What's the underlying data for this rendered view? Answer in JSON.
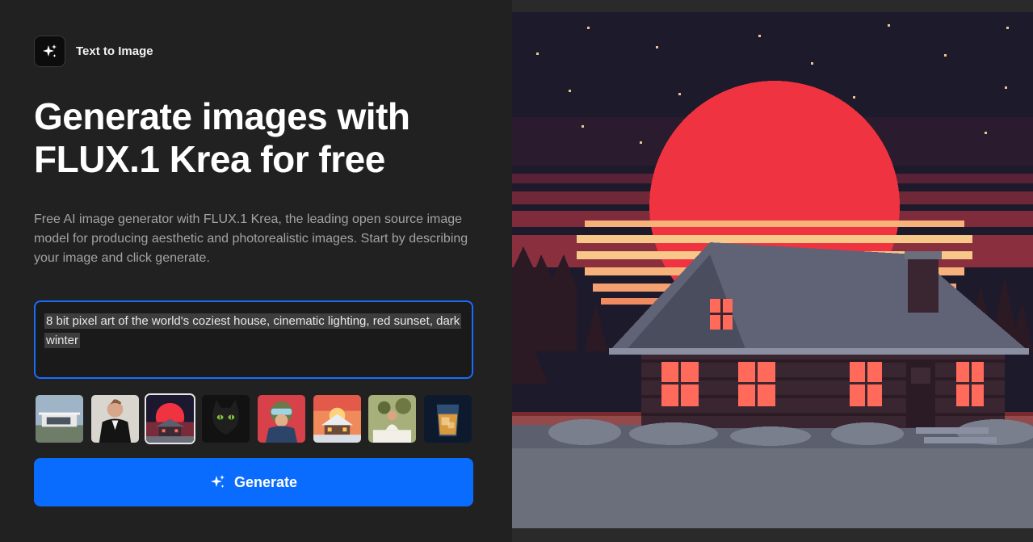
{
  "badge": {
    "label": "Text to Image",
    "icon": "sparkle-icon"
  },
  "hero": {
    "title": "Generate images with FLUX.1 Krea for free",
    "description": "Free AI image generator with FLUX.1 Krea, the leading open source image model for producing aesthetic and photorealistic images. Start by describing your image and click generate."
  },
  "prompt": {
    "value": "8 bit pixel art of the world's coziest house, cinematic lighting, red sunset, dark winter"
  },
  "examples": [
    {
      "name": "modern-house"
    },
    {
      "name": "man-in-tuxedo"
    },
    {
      "name": "pixel-house-sunset",
      "selected": true
    },
    {
      "name": "black-cat"
    },
    {
      "name": "pilot-portrait"
    },
    {
      "name": "snowy-cabin"
    },
    {
      "name": "dinner-party"
    },
    {
      "name": "cocktail-glass"
    }
  ],
  "generate": {
    "label": "Generate",
    "icon": "sparkle-icon"
  },
  "colors": {
    "accent": "#0a6bff",
    "background": "#212121",
    "sun": "#ef3340"
  }
}
